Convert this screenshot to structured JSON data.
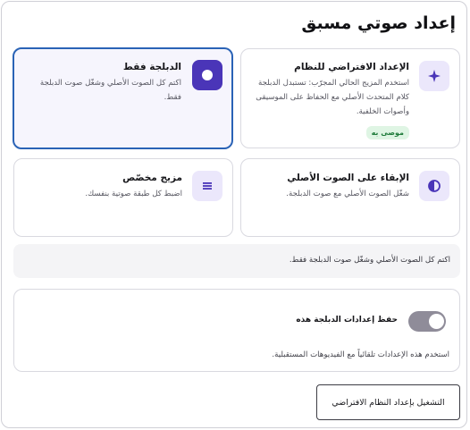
{
  "dialog": {
    "title": "إعداد صوتي مسبق"
  },
  "presets": [
    {
      "id": "system-default",
      "title": "الإعداد الافتراضي للنظام",
      "description": "استخدم المزيج الحالي المجرّب: تستبدل الدبلجة كلام المتحدث الأصلي مع الحفاظ على الموسيقى وأصوات الخلفية.",
      "badge": "موصى به",
      "icon": "sparkle-icon",
      "selected": false
    },
    {
      "id": "dubbing-only",
      "title": "الدبلجة فقط",
      "description": "اكتم كل الصوت الأصلي وشغّل صوت الدبلجة فقط.",
      "icon": "record-icon",
      "selected": true
    },
    {
      "id": "keep-original",
      "title": "الإبقاء على الصوت الأصلي",
      "description": "شغّل الصوت الأصلي مع صوت الدبلجة.",
      "icon": "half-circle-icon",
      "selected": false
    },
    {
      "id": "custom-mix",
      "title": "مزيج مخصّص",
      "description": "اضبط كل طبقة صوتية بنفسك.",
      "icon": "menu-lines-icon",
      "selected": false
    }
  ],
  "info": {
    "text": "اكتم كل الصوت الأصلي وشغّل صوت الدبلجة فقط."
  },
  "settings": {
    "save_label": "حفظ إعدادات الدبلجة هذه",
    "save_enabled": true,
    "help": "استخدم هذه الإعدادات تلقائياً مع الفيديوهات المستقبلية."
  },
  "footer": {
    "reset_label": "التشغيل بإعداد النظام الافتراضي"
  },
  "colors": {
    "accent": "#4a35b8",
    "selected_border": "#2a63b6",
    "badge_bg": "#dff5e4",
    "badge_text": "#1e7a3a"
  }
}
